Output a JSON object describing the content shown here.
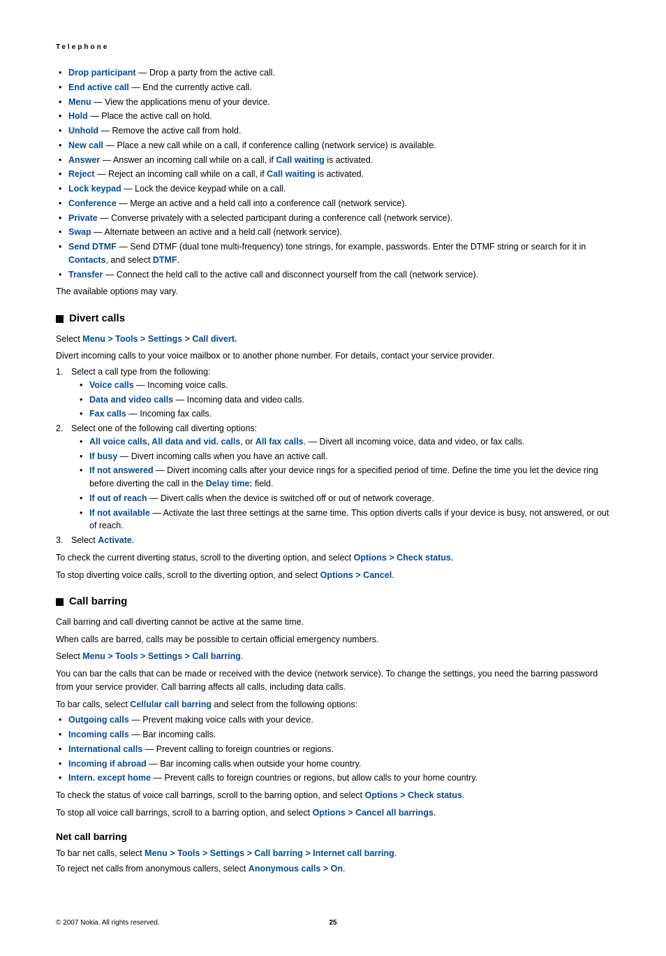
{
  "header": "Telephone",
  "topOptions": [
    {
      "label": "Drop participant",
      "desc": " — Drop a party from the active call."
    },
    {
      "label": "End active call",
      "desc": " — End the currently active call."
    },
    {
      "label": "Menu",
      "desc": " — View the applications menu of your device."
    },
    {
      "label": "Hold",
      "desc": " — Place the active call on hold."
    },
    {
      "label": "Unhold",
      "desc": " — Remove the active call from hold."
    },
    {
      "label": "New call",
      "desc": " — Place a new call while on a call, if conference calling (network service) is available."
    },
    {
      "label": "Answer",
      "descPre": " — Answer an incoming call while on a call, if ",
      "mid": "Call waiting",
      "descPost": " is activated."
    },
    {
      "label": "Reject",
      "descPre": " — Reject an incoming call while on a call, if ",
      "mid": "Call waiting",
      "descPost": " is activated."
    },
    {
      "label": "Lock keypad",
      "desc": " — Lock the device keypad while on a call."
    },
    {
      "label": "Conference",
      "desc": " — Merge an active and a held call into a conference call (network service)."
    },
    {
      "label": "Private",
      "desc": " — Converse privately with a selected participant during a conference call (network service)."
    },
    {
      "label": "Swap",
      "desc": " — Alternate between an active and a held call (network service)."
    },
    {
      "label": "Send DTMF",
      "descPre": " — Send DTMF (dual tone multi-frequency) tone strings, for example, passwords. Enter the DTMF string or search for it in ",
      "mid": "Contacts",
      "descMid2": ", and select ",
      "mid2": "DTMF",
      "descPost": "."
    },
    {
      "label": "Transfer",
      "desc": " — Connect the held call to the active call and disconnect yourself from the call (network service)."
    }
  ],
  "topTail": "The available options may vary.",
  "divert": {
    "heading": "Divert calls",
    "selectPrefix": "Select ",
    "path": [
      "Menu",
      "Tools",
      "Settings",
      "Call divert"
    ],
    "pathTail": ".",
    "intro": "Divert incoming calls to your voice mailbox or to another phone number. For details, contact your service provider.",
    "step1": "Select a call type from the following:",
    "callTypes": [
      {
        "label": "Voice calls",
        "desc": " — Incoming voice calls."
      },
      {
        "label": "Data and video calls",
        "desc": " — Incoming data and video calls."
      },
      {
        "label": "Fax calls",
        "desc": " — Incoming fax calls."
      }
    ],
    "step2": "Select one of the following call diverting options:",
    "divertOpts": {
      "allPre": "",
      "all1": "All voice calls",
      "allSep1": ", ",
      "all2": "All data and vid. calls",
      "allSep2": ", or ",
      "all3": "All fax calls",
      "allTail": ". — Divert all incoming voice, data and video, or fax calls.",
      "busy": {
        "label": "If busy",
        "desc": " — Divert incoming calls when you have an active call."
      },
      "notAns": {
        "label": "If not answered",
        "descPre": " — Divert incoming calls after your device rings for a specified period of time. Define the time you let the device ring before diverting the call in the ",
        "mid": "Delay time:",
        "descPost": " field."
      },
      "outReach": {
        "label": "If out of reach",
        "desc": " — Divert calls when the device is switched off or out of network coverage."
      },
      "notAvail": {
        "label": "If not available",
        "desc": " — Activate the last three settings at the same time. This option diverts calls if your device is busy, not answered, or out of reach."
      }
    },
    "step3Pre": "Select ",
    "step3Label": "Activate",
    "step3Post": ".",
    "checkPre": "To check the current diverting status, scroll to the diverting option, and select ",
    "checkOpt": "Options",
    "checkStatus": "Check status",
    "checkPost": ".",
    "stopPre": "To stop diverting voice calls, scroll to the diverting option, and select ",
    "stopOpt": "Options",
    "stopCancel": "Cancel",
    "stopPost": "."
  },
  "barring": {
    "heading": "Call barring",
    "line1": "Call barring and call diverting cannot be active at the same time.",
    "line2": "When calls are barred, calls may be possible to certain official emergency numbers.",
    "selectPrefix": "Select ",
    "path": [
      "Menu",
      "Tools",
      "Settings",
      "Call barring"
    ],
    "pathTail": ".",
    "para": "You can bar the calls that can be made or received with the device (network service). To change the settings, you need the barring password from your service provider. Call barring affects all calls, including data calls.",
    "toBarPre": "To bar calls, select ",
    "cellular": "Cellular call barring",
    "toBarPost": " and select from the following options:",
    "opts": [
      {
        "label": "Outgoing calls",
        "desc": " — Prevent making voice calls with your device."
      },
      {
        "label": "Incoming calls",
        "desc": " — Bar incoming calls."
      },
      {
        "label": "International calls",
        "desc": " — Prevent calling to foreign countries or regions."
      },
      {
        "label": "Incoming if abroad",
        "desc": " — Bar incoming calls when outside your home country."
      },
      {
        "label": "Intern. except home",
        "desc": " — Prevent calls to foreign countries or regions, but allow calls to your home country."
      }
    ],
    "checkPre": "To check the status of voice call barrings, scroll to the barring option, and select ",
    "checkOpt": "Options",
    "checkStatus": "Check status",
    "checkPost": ".",
    "stopPre": "To stop all voice call barrings, scroll to a barring option, and select ",
    "stopOpt": "Options",
    "stopCancel": "Cancel all barrings",
    "stopPost": "."
  },
  "net": {
    "heading": "Net call barring",
    "barPre": "To bar net calls, select ",
    "path": [
      "Menu",
      "Tools",
      "Settings",
      "Call barring",
      "Internet call barring"
    ],
    "barPost": ".",
    "rejectPre": "To reject net calls from anonymous callers, select ",
    "anon": "Anonymous calls",
    "on": "On",
    "rejectPost": "."
  },
  "footer": {
    "copyright": "© 2007 Nokia. All rights reserved.",
    "page": "25"
  },
  "chev": ">"
}
